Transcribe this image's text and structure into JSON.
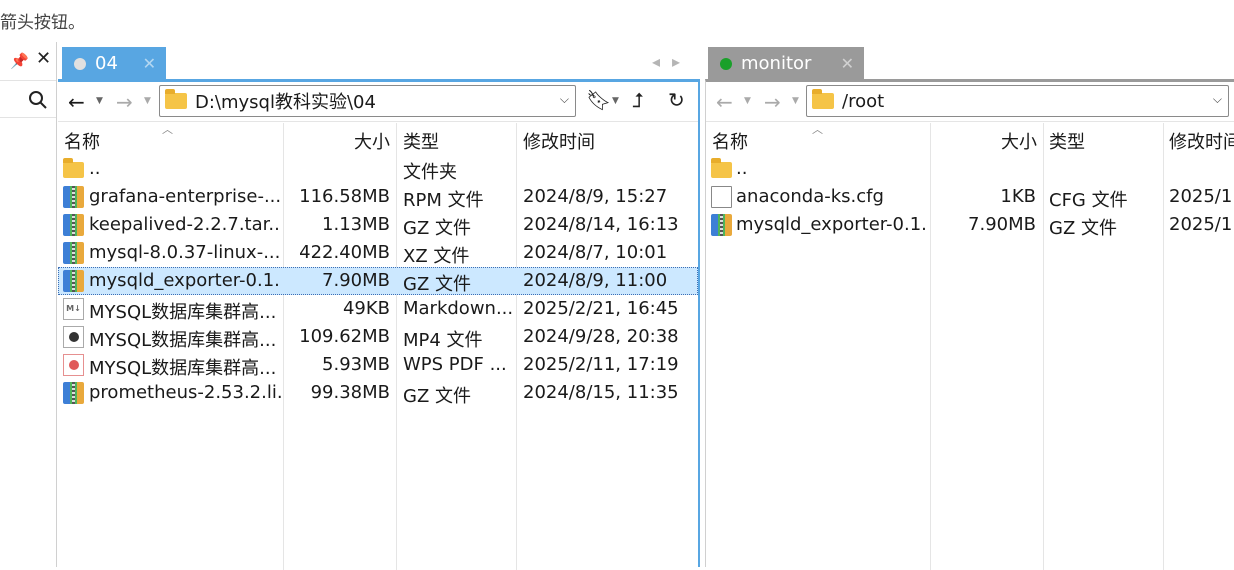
{
  "top_hint": "箭头按钮。",
  "left_tab": {
    "label": "04",
    "dot_color": "#e0e0e0"
  },
  "right_tab": {
    "label": "monitor",
    "dot_color": "#1aa02a"
  },
  "tab_nav": {
    "prev": "◂",
    "next": "▸"
  },
  "sidebar": {
    "pin": "📌",
    "close": "✕"
  },
  "left_panel": {
    "path": "D:\\mysql教科实验\\04",
    "columns": {
      "name": "名称",
      "size": "大小",
      "type": "类型",
      "modified": "修改时间"
    },
    "rows": [
      {
        "icon": "folder",
        "name": "..",
        "size": "",
        "type": "文件夹",
        "modified": ""
      },
      {
        "icon": "archive",
        "name": "grafana-enterprise-...",
        "size": "116.58MB",
        "type": "RPM 文件",
        "modified": "2024/8/9, 15:27"
      },
      {
        "icon": "archive",
        "name": "keepalived-2.2.7.tar....",
        "size": "1.13MB",
        "type": "GZ 文件",
        "modified": "2024/8/14, 16:13"
      },
      {
        "icon": "archive",
        "name": "mysql-8.0.37-linux-...",
        "size": "422.40MB",
        "type": "XZ 文件",
        "modified": "2024/8/7, 10:01"
      },
      {
        "icon": "archive",
        "name": "mysqld_exporter-0.1...",
        "size": "7.90MB",
        "type": "GZ 文件",
        "modified": "2024/8/9, 11:00",
        "selected": true
      },
      {
        "icon": "md",
        "name": "MYSQL数据库集群高...",
        "size": "49KB",
        "type": "Markdown...",
        "modified": "2025/2/21, 16:45"
      },
      {
        "icon": "mp4",
        "name": "MYSQL数据库集群高...",
        "size": "109.62MB",
        "type": "MP4 文件",
        "modified": "2024/9/28, 20:38"
      },
      {
        "icon": "pdf",
        "name": "MYSQL数据库集群高...",
        "size": "5.93MB",
        "type": "WPS PDF ...",
        "modified": "2025/2/11, 17:19"
      },
      {
        "icon": "archive",
        "name": "prometheus-2.53.2.li...",
        "size": "99.38MB",
        "type": "GZ 文件",
        "modified": "2024/8/15, 11:35"
      }
    ]
  },
  "right_panel": {
    "path": "/root",
    "columns": {
      "name": "名称",
      "size": "大小",
      "type": "类型",
      "modified": "修改时间"
    },
    "rows": [
      {
        "icon": "folder",
        "name": "..",
        "size": "",
        "type": "",
        "modified": ""
      },
      {
        "icon": "file",
        "name": "anaconda-ks.cfg",
        "size": "1KB",
        "type": "CFG 文件",
        "modified": "2025/1"
      },
      {
        "icon": "archive",
        "name": "mysqld_exporter-0.1...",
        "size": "7.90MB",
        "type": "GZ 文件",
        "modified": "2025/1"
      }
    ]
  }
}
